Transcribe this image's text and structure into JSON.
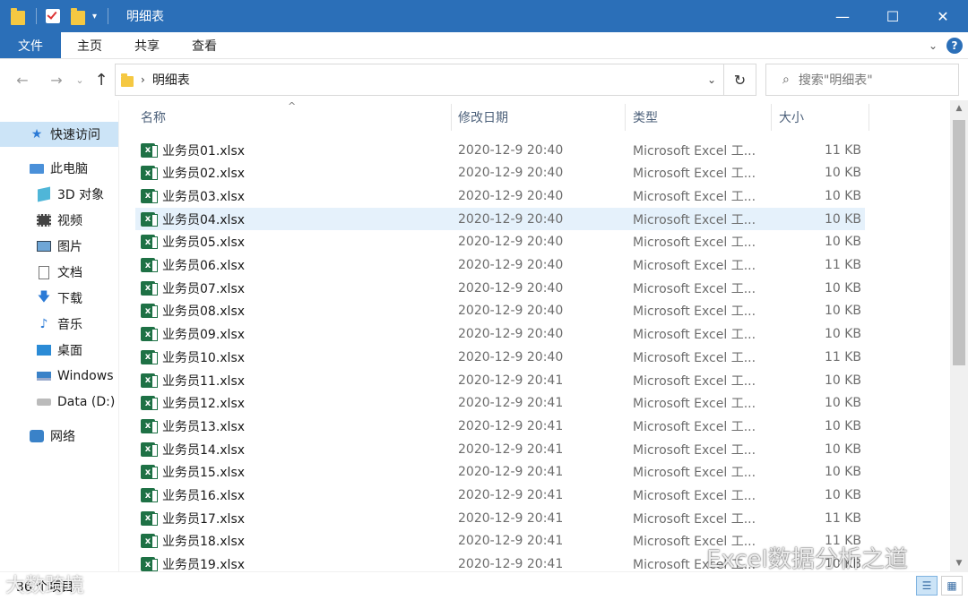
{
  "window": {
    "title": "明细表",
    "minimize": "—",
    "maximize": "☐",
    "close": "✕"
  },
  "ribbon": {
    "tabs": [
      "文件",
      "主页",
      "共享",
      "查看"
    ],
    "collapse": "⌄",
    "help": "?"
  },
  "address": {
    "back": "←",
    "forward": "→",
    "recent": "⌄",
    "up": "↑",
    "path_separator": "›",
    "path": "明细表",
    "dropdown": "⌄",
    "refresh": "↻",
    "search_placeholder": "搜索\"明细表\"",
    "search_icon": "⌕"
  },
  "nav": {
    "items": [
      {
        "label": "快速访问",
        "icon": "star-icon",
        "glyph": "★"
      },
      {
        "label": "此电脑",
        "icon": "computer-icon",
        "glyph": ""
      },
      {
        "label": "3D 对象",
        "icon": "cube-icon",
        "glyph": ""
      },
      {
        "label": "视频",
        "icon": "video-icon",
        "glyph": ""
      },
      {
        "label": "图片",
        "icon": "picture-icon",
        "glyph": ""
      },
      {
        "label": "文档",
        "icon": "document-icon",
        "glyph": ""
      },
      {
        "label": "下载",
        "icon": "download-icon",
        "glyph": "🡇"
      },
      {
        "label": "音乐",
        "icon": "music-icon",
        "glyph": "♪"
      },
      {
        "label": "桌面",
        "icon": "desktop-icon",
        "glyph": ""
      },
      {
        "label": "Windows",
        "icon": "drive-icon",
        "glyph": ""
      },
      {
        "label": "Data (D:)",
        "icon": "drive-icon",
        "glyph": ""
      },
      {
        "label": "网络",
        "icon": "network-icon",
        "glyph": ""
      }
    ]
  },
  "columns": {
    "name": "名称",
    "modified": "修改日期",
    "type": "类型",
    "size": "大小",
    "sort_indicator": "^"
  },
  "files": [
    {
      "name": "业务员01.xlsx",
      "modified": "2020-12-9 20:40",
      "type": "Microsoft Excel 工...",
      "size": "11 KB"
    },
    {
      "name": "业务员02.xlsx",
      "modified": "2020-12-9 20:40",
      "type": "Microsoft Excel 工...",
      "size": "10 KB"
    },
    {
      "name": "业务员03.xlsx",
      "modified": "2020-12-9 20:40",
      "type": "Microsoft Excel 工...",
      "size": "10 KB"
    },
    {
      "name": "业务员04.xlsx",
      "modified": "2020-12-9 20:40",
      "type": "Microsoft Excel 工...",
      "size": "10 KB"
    },
    {
      "name": "业务员05.xlsx",
      "modified": "2020-12-9 20:40",
      "type": "Microsoft Excel 工...",
      "size": "10 KB"
    },
    {
      "name": "业务员06.xlsx",
      "modified": "2020-12-9 20:40",
      "type": "Microsoft Excel 工...",
      "size": "11 KB"
    },
    {
      "name": "业务员07.xlsx",
      "modified": "2020-12-9 20:40",
      "type": "Microsoft Excel 工...",
      "size": "10 KB"
    },
    {
      "name": "业务员08.xlsx",
      "modified": "2020-12-9 20:40",
      "type": "Microsoft Excel 工...",
      "size": "10 KB"
    },
    {
      "name": "业务员09.xlsx",
      "modified": "2020-12-9 20:40",
      "type": "Microsoft Excel 工...",
      "size": "10 KB"
    },
    {
      "name": "业务员10.xlsx",
      "modified": "2020-12-9 20:40",
      "type": "Microsoft Excel 工...",
      "size": "11 KB"
    },
    {
      "name": "业务员11.xlsx",
      "modified": "2020-12-9 20:41",
      "type": "Microsoft Excel 工...",
      "size": "10 KB"
    },
    {
      "name": "业务员12.xlsx",
      "modified": "2020-12-9 20:41",
      "type": "Microsoft Excel 工...",
      "size": "10 KB"
    },
    {
      "name": "业务员13.xlsx",
      "modified": "2020-12-9 20:41",
      "type": "Microsoft Excel 工...",
      "size": "10 KB"
    },
    {
      "name": "业务员14.xlsx",
      "modified": "2020-12-9 20:41",
      "type": "Microsoft Excel 工...",
      "size": "10 KB"
    },
    {
      "name": "业务员15.xlsx",
      "modified": "2020-12-9 20:41",
      "type": "Microsoft Excel 工...",
      "size": "10 KB"
    },
    {
      "name": "业务员16.xlsx",
      "modified": "2020-12-9 20:41",
      "type": "Microsoft Excel 工...",
      "size": "10 KB"
    },
    {
      "name": "业务员17.xlsx",
      "modified": "2020-12-9 20:41",
      "type": "Microsoft Excel 工...",
      "size": "11 KB"
    },
    {
      "name": "业务员18.xlsx",
      "modified": "2020-12-9 20:41",
      "type": "Microsoft Excel 工...",
      "size": "11 KB"
    },
    {
      "name": "业务员19.xlsx",
      "modified": "2020-12-9 20:41",
      "type": "Microsoft Excel 工...",
      "size": "10 KB"
    }
  ],
  "selected_row": 3,
  "status": {
    "item_count": "36 个项目"
  },
  "view_buttons": [
    "details-view",
    "large-icons-view"
  ],
  "watermark": "Excel数据分析之道",
  "watermark2": "大数跨境",
  "colors": {
    "titlebar": "#2b6fb8",
    "selection": "#cce4f7",
    "row_selected": "#e5f1fb",
    "excel_green": "#1e7145"
  }
}
